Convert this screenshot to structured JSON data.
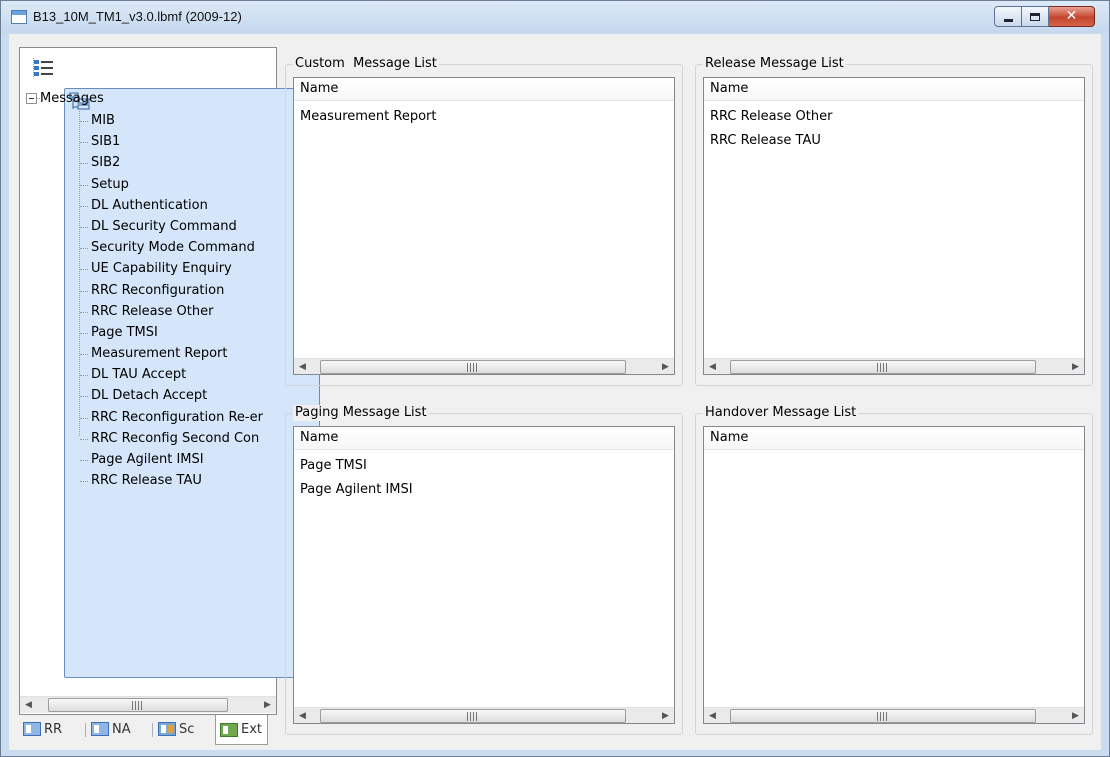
{
  "window": {
    "title": "B13_10M_TM1_v3.0.lbmf (2009-12)",
    "close_glyph": "✕"
  },
  "left_panel": {
    "toolbar": [
      {
        "icon": "list-view-icon"
      },
      {
        "icon": "tree-view-icon",
        "selected": true
      }
    ],
    "tree": {
      "root_label": "Messages",
      "expanded": true,
      "items": [
        "MIB",
        "SIB1",
        "SIB2",
        "Setup",
        "DL Authentication",
        "DL Security Command",
        "Security Mode Command",
        "UE Capability Enquiry",
        "RRC Reconfiguration",
        "RRC Release Other",
        "Page TMSI",
        "Measurement Report",
        "DL TAU Accept",
        "DL Detach Accept",
        "RRC Reconfiguration Re-er",
        "RRC Reconfig Second Con",
        "Page Agilent IMSI",
        "RRC Release TAU"
      ]
    },
    "scroll_grip": "III"
  },
  "tabs": [
    {
      "label": "RR",
      "icon": "rr-tab-icon"
    },
    {
      "label": "NA",
      "icon": "na-tab-icon"
    },
    {
      "label": "Sc",
      "icon": "sc-tab-icon"
    },
    {
      "label": "Ext",
      "icon": "ext-tab-icon",
      "active": true
    }
  ],
  "panels": {
    "custom": {
      "title": "Custom  Message List",
      "column": "Name",
      "rows": [
        "Measurement Report"
      ]
    },
    "release": {
      "title": "Release Message List",
      "column": "Name",
      "rows": [
        "RRC Release Other",
        "RRC Release TAU"
      ]
    },
    "paging": {
      "title": "Paging Message List",
      "column": "Name",
      "rows": [
        "Page TMSI",
        "Page Agilent IMSI"
      ]
    },
    "handover": {
      "title": "Handover Message List",
      "column": "Name",
      "rows": []
    }
  },
  "colors": {
    "window_frame": "#c9dcf0",
    "client_bg": "#f0f0f0",
    "close_button": "#c5452d",
    "tree_selected_tool": "#d6e6fa"
  }
}
